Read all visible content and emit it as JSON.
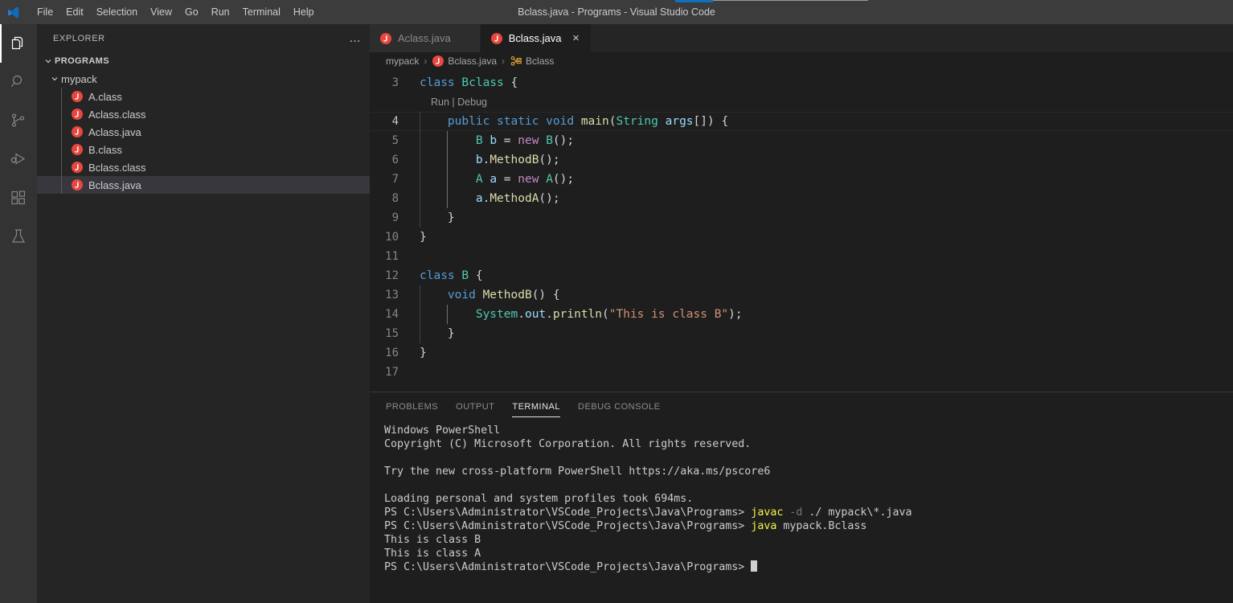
{
  "window": {
    "title": "Bclass.java - Programs - Visual Studio Code",
    "accent_color": "#0e70c0"
  },
  "menubar": {
    "items": [
      "File",
      "Edit",
      "Selection",
      "View",
      "Go",
      "Run",
      "Terminal",
      "Help"
    ]
  },
  "activitybar": {
    "items": [
      {
        "name": "explorer",
        "icon": "files-icon",
        "active": true
      },
      {
        "name": "search",
        "icon": "search-icon",
        "active": false
      },
      {
        "name": "source-control",
        "icon": "source-control-icon",
        "active": false
      },
      {
        "name": "run-and-debug",
        "icon": "run-debug-icon",
        "active": false
      },
      {
        "name": "extensions",
        "icon": "extensions-icon",
        "active": false
      },
      {
        "name": "testing",
        "icon": "beaker-icon",
        "active": false
      }
    ]
  },
  "sidebar": {
    "title": "EXPLORER",
    "more_actions": "…",
    "root": {
      "label": "PROGRAMS",
      "expanded": true
    },
    "folder": {
      "label": "mypack",
      "expanded": true
    },
    "files": [
      {
        "label": "A.class",
        "icon": "java-file-icon",
        "selected": false
      },
      {
        "label": "Aclass.class",
        "icon": "java-file-icon",
        "selected": false
      },
      {
        "label": "Aclass.java",
        "icon": "java-file-icon",
        "selected": false
      },
      {
        "label": "B.class",
        "icon": "java-file-icon",
        "selected": false
      },
      {
        "label": "Bclass.class",
        "icon": "java-file-icon",
        "selected": false
      },
      {
        "label": "Bclass.java",
        "icon": "java-file-icon",
        "selected": true
      }
    ]
  },
  "tabs": [
    {
      "label": "Aclass.java",
      "icon": "java-file-icon",
      "active": false,
      "close": "×"
    },
    {
      "label": "Bclass.java",
      "icon": "java-file-icon",
      "active": true,
      "close": "×"
    }
  ],
  "breadcrumbs": {
    "separator": "›",
    "items": [
      {
        "label": "mypack",
        "icon": null
      },
      {
        "label": "Bclass.java",
        "icon": "java-file-icon"
      },
      {
        "label": "Bclass",
        "icon": "class-symbol-icon"
      }
    ]
  },
  "editor": {
    "codelens": {
      "run": "Run",
      "sep": "|",
      "debug": "Debug"
    },
    "current_line": 4,
    "lines": [
      {
        "n": "3",
        "tokens": [
          {
            "t": "class",
            "c": "k-key"
          },
          {
            "t": " ",
            "c": "k-plain"
          },
          {
            "t": "Bclass",
            "c": "k-type"
          },
          {
            "t": " {",
            "c": "k-plain"
          }
        ],
        "indent_guides": []
      },
      {
        "n": "4",
        "tokens": [
          {
            "t": "    ",
            "c": "k-plain"
          },
          {
            "t": "public",
            "c": "k-key"
          },
          {
            "t": " ",
            "c": "k-plain"
          },
          {
            "t": "static",
            "c": "k-key"
          },
          {
            "t": " ",
            "c": "k-plain"
          },
          {
            "t": "void",
            "c": "k-key"
          },
          {
            "t": " ",
            "c": "k-plain"
          },
          {
            "t": "main",
            "c": "k-fn"
          },
          {
            "t": "(",
            "c": "k-plain"
          },
          {
            "t": "String",
            "c": "k-type"
          },
          {
            "t": " ",
            "c": "k-plain"
          },
          {
            "t": "args",
            "c": "k-var"
          },
          {
            "t": "[]) {",
            "c": "k-plain"
          }
        ],
        "indent_guides": [
          0
        ]
      },
      {
        "n": "5",
        "tokens": [
          {
            "t": "        ",
            "c": "k-plain"
          },
          {
            "t": "B",
            "c": "k-type"
          },
          {
            "t": " ",
            "c": "k-plain"
          },
          {
            "t": "b",
            "c": "k-var"
          },
          {
            "t": " = ",
            "c": "k-plain"
          },
          {
            "t": "new",
            "c": "k-ctrl"
          },
          {
            "t": " ",
            "c": "k-plain"
          },
          {
            "t": "B",
            "c": "k-type"
          },
          {
            "t": "();",
            "c": "k-plain"
          }
        ],
        "indent_guides": [
          0,
          1
        ]
      },
      {
        "n": "6",
        "tokens": [
          {
            "t": "        ",
            "c": "k-plain"
          },
          {
            "t": "b",
            "c": "k-var"
          },
          {
            "t": ".",
            "c": "k-plain"
          },
          {
            "t": "MethodB",
            "c": "k-fn"
          },
          {
            "t": "();",
            "c": "k-plain"
          }
        ],
        "indent_guides": [
          0,
          1
        ]
      },
      {
        "n": "7",
        "tokens": [
          {
            "t": "        ",
            "c": "k-plain"
          },
          {
            "t": "A",
            "c": "k-type"
          },
          {
            "t": " ",
            "c": "k-plain"
          },
          {
            "t": "a",
            "c": "k-var"
          },
          {
            "t": " = ",
            "c": "k-plain"
          },
          {
            "t": "new",
            "c": "k-ctrl"
          },
          {
            "t": " ",
            "c": "k-plain"
          },
          {
            "t": "A",
            "c": "k-type"
          },
          {
            "t": "();",
            "c": "k-plain"
          }
        ],
        "indent_guides": [
          0,
          1
        ]
      },
      {
        "n": "8",
        "tokens": [
          {
            "t": "        ",
            "c": "k-plain"
          },
          {
            "t": "a",
            "c": "k-var"
          },
          {
            "t": ".",
            "c": "k-plain"
          },
          {
            "t": "MethodA",
            "c": "k-fn"
          },
          {
            "t": "();",
            "c": "k-plain"
          }
        ],
        "indent_guides": [
          0,
          1
        ]
      },
      {
        "n": "9",
        "tokens": [
          {
            "t": "    }",
            "c": "k-plain"
          }
        ],
        "indent_guides": [
          0
        ]
      },
      {
        "n": "10",
        "tokens": [
          {
            "t": "}",
            "c": "k-plain"
          }
        ],
        "indent_guides": []
      },
      {
        "n": "11",
        "tokens": [],
        "indent_guides": []
      },
      {
        "n": "12",
        "tokens": [
          {
            "t": "class",
            "c": "k-key"
          },
          {
            "t": " ",
            "c": "k-plain"
          },
          {
            "t": "B",
            "c": "k-type"
          },
          {
            "t": " {",
            "c": "k-plain"
          }
        ],
        "indent_guides": []
      },
      {
        "n": "13",
        "tokens": [
          {
            "t": "    ",
            "c": "k-plain"
          },
          {
            "t": "void",
            "c": "k-key"
          },
          {
            "t": " ",
            "c": "k-plain"
          },
          {
            "t": "MethodB",
            "c": "k-fn"
          },
          {
            "t": "() {",
            "c": "k-plain"
          }
        ],
        "indent_guides": [
          0
        ]
      },
      {
        "n": "14",
        "tokens": [
          {
            "t": "        ",
            "c": "k-plain"
          },
          {
            "t": "System",
            "c": "k-type"
          },
          {
            "t": ".",
            "c": "k-plain"
          },
          {
            "t": "out",
            "c": "k-var"
          },
          {
            "t": ".",
            "c": "k-plain"
          },
          {
            "t": "println",
            "c": "k-fn"
          },
          {
            "t": "(",
            "c": "k-plain"
          },
          {
            "t": "\"This is class B\"",
            "c": "k-str"
          },
          {
            "t": ");",
            "c": "k-plain"
          }
        ],
        "indent_guides": [
          0,
          1
        ]
      },
      {
        "n": "15",
        "tokens": [
          {
            "t": "    }",
            "c": "k-plain"
          }
        ],
        "indent_guides": [
          0
        ]
      },
      {
        "n": "16",
        "tokens": [
          {
            "t": "}",
            "c": "k-plain"
          }
        ],
        "indent_guides": []
      },
      {
        "n": "17",
        "tokens": [],
        "indent_guides": []
      }
    ]
  },
  "panel": {
    "tabs": [
      {
        "label": "PROBLEMS",
        "active": false
      },
      {
        "label": "OUTPUT",
        "active": false
      },
      {
        "label": "TERMINAL",
        "active": true
      },
      {
        "label": "DEBUG CONSOLE",
        "active": false
      }
    ],
    "terminal": {
      "lines": [
        [
          {
            "t": "Windows PowerShell",
            "c": ""
          }
        ],
        [
          {
            "t": "Copyright (C) Microsoft Corporation. All rights reserved.",
            "c": ""
          }
        ],
        [
          {
            "t": "",
            "c": ""
          }
        ],
        [
          {
            "t": "Try the new cross-platform PowerShell https://aka.ms/pscore6",
            "c": ""
          }
        ],
        [
          {
            "t": "",
            "c": ""
          }
        ],
        [
          {
            "t": "Loading personal and system profiles took 694ms.",
            "c": ""
          }
        ],
        [
          {
            "t": "PS C:\\Users\\Administrator\\VSCode_Projects\\Java\\Programs> ",
            "c": ""
          },
          {
            "t": "javac",
            "c": "t-cmd"
          },
          {
            "t": " ",
            "c": ""
          },
          {
            "t": "-d",
            "c": "t-flag"
          },
          {
            "t": " ./ mypack\\*.java",
            "c": ""
          }
        ],
        [
          {
            "t": "PS C:\\Users\\Administrator\\VSCode_Projects\\Java\\Programs> ",
            "c": ""
          },
          {
            "t": "java",
            "c": "t-cmd"
          },
          {
            "t": " mypack.Bclass",
            "c": ""
          }
        ],
        [
          {
            "t": "This is class B",
            "c": ""
          }
        ],
        [
          {
            "t": "This is class A",
            "c": ""
          }
        ],
        [
          {
            "t": "PS C:\\Users\\Administrator\\VSCode_Projects\\Java\\Programs> ",
            "c": ""
          },
          {
            "t": "",
            "c": "cursor"
          }
        ]
      ]
    }
  }
}
